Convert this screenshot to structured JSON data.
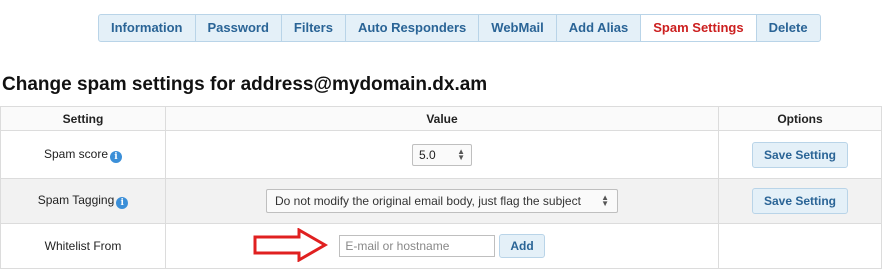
{
  "tabs": [
    {
      "label": "Information",
      "active": false
    },
    {
      "label": "Password",
      "active": false
    },
    {
      "label": "Filters",
      "active": false
    },
    {
      "label": "Auto Responders",
      "active": false
    },
    {
      "label": "WebMail",
      "active": false
    },
    {
      "label": "Add Alias",
      "active": false
    },
    {
      "label": "Spam Settings",
      "active": true
    },
    {
      "label": "Delete",
      "active": false
    }
  ],
  "heading": "Change spam settings for address@mydomain.dx.am",
  "table": {
    "headers": {
      "setting": "Setting",
      "value": "Value",
      "options": "Options"
    },
    "rows": {
      "spam_score": {
        "label": "Spam score",
        "value": "5.0",
        "button": "Save Setting"
      },
      "spam_tagging": {
        "label": "Spam Tagging",
        "selected": "Do not modify the original email body, just flag the subject",
        "button": "Save Setting"
      },
      "whitelist": {
        "label": "Whitelist From",
        "placeholder": "E-mail or hostname",
        "button": "Add"
      }
    }
  },
  "icons": {
    "info": "info-icon",
    "arrow": "red-arrow-annotation"
  },
  "colors": {
    "accent": "#2a6496",
    "active_tab": "#cc1f1f",
    "tab_bg": "#e4f0f8",
    "info_icon": "#3b8fd8",
    "annotation": "#e02020"
  }
}
